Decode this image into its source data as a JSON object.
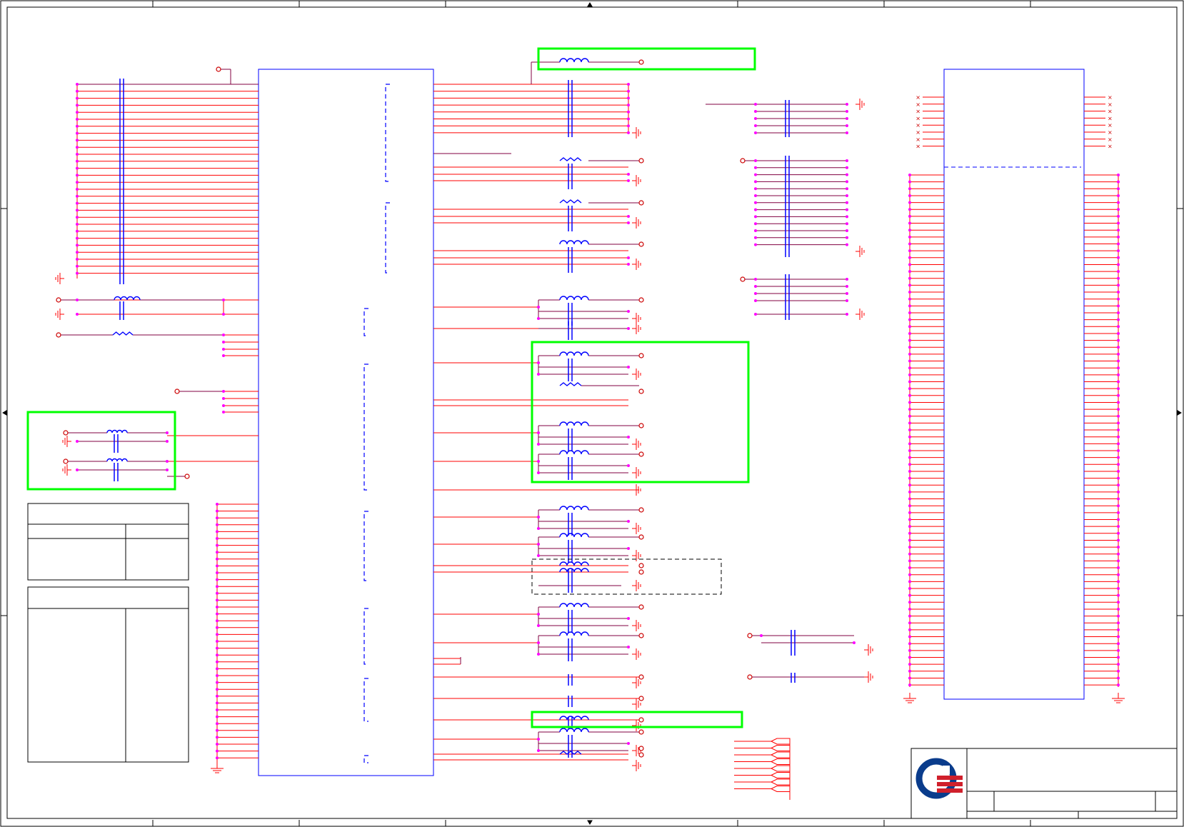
{
  "sheet": {
    "title": "",
    "colors": {
      "frame": "#000000",
      "body": "#0000ff",
      "wire": "#ff0000",
      "net": "#800040",
      "junction": "#ff00ff",
      "highlight": "#00ff00",
      "logo_blue": "#0a3c8c",
      "logo_red": "#d0202c"
    }
  },
  "components": {
    "main_ic": "main-ic-body",
    "connector": "connector-body",
    "power_symbol": "ground-symbol",
    "passives": [
      "capacitor-icon",
      "inductor-icon",
      "resistor-icon"
    ]
  },
  "title_block": {
    "logo": "company-logo",
    "rows": []
  }
}
